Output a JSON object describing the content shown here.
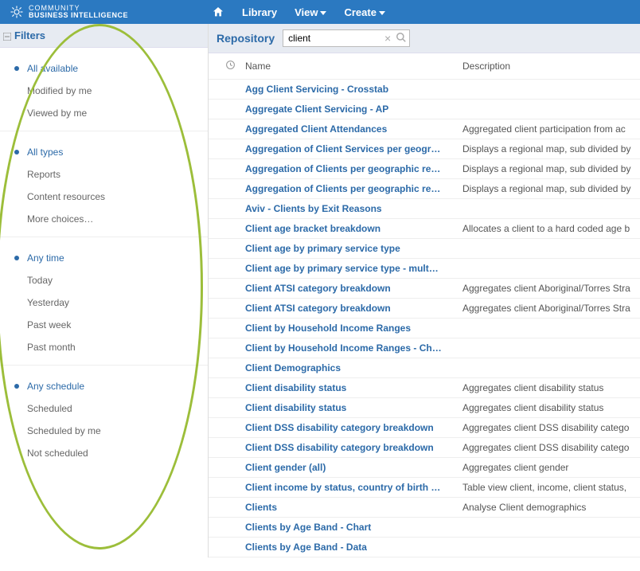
{
  "brand": {
    "line1": "COMMUNITY",
    "line2": "BUSINESS INTELLIGENCE"
  },
  "nav": {
    "library": "Library",
    "view": "View",
    "create": "Create"
  },
  "sidebar": {
    "title": "Filters",
    "groups": [
      {
        "items": [
          {
            "label": "All available",
            "selected": true
          },
          {
            "label": "Modified by me",
            "selected": false
          },
          {
            "label": "Viewed by me",
            "selected": false
          }
        ]
      },
      {
        "items": [
          {
            "label": "All types",
            "selected": true
          },
          {
            "label": "Reports",
            "selected": false
          },
          {
            "label": "Content resources",
            "selected": false
          },
          {
            "label": "More choices…",
            "selected": false
          }
        ]
      },
      {
        "items": [
          {
            "label": "Any time",
            "selected": true
          },
          {
            "label": "Today",
            "selected": false
          },
          {
            "label": "Yesterday",
            "selected": false
          },
          {
            "label": "Past week",
            "selected": false
          },
          {
            "label": "Past month",
            "selected": false
          }
        ]
      },
      {
        "items": [
          {
            "label": "Any schedule",
            "selected": true
          },
          {
            "label": "Scheduled",
            "selected": false
          },
          {
            "label": "Scheduled by me",
            "selected": false
          },
          {
            "label": "Not scheduled",
            "selected": false
          }
        ]
      }
    ]
  },
  "main": {
    "title": "Repository",
    "search_value": "client",
    "columns": {
      "name": "Name",
      "description": "Description"
    },
    "rows": [
      {
        "name": "Agg Client Servicing - Crosstab",
        "desc": ""
      },
      {
        "name": "Aggregate Client Servicing - AP",
        "desc": ""
      },
      {
        "name": "Aggregated Client Attendances",
        "desc": "Aggregated client participation from ac"
      },
      {
        "name": "Aggregation of Client Services per geogr…",
        "desc": "Displays a regional map, sub divided by"
      },
      {
        "name": "Aggregation of Clients per geographic re…",
        "desc": "Displays a regional map, sub divided by"
      },
      {
        "name": "Aggregation of Clients per geographic re…",
        "desc": "Displays a regional map, sub divided by"
      },
      {
        "name": "Aviv - Clients by Exit Reasons",
        "desc": ""
      },
      {
        "name": "Client age bracket breakdown",
        "desc": "Allocates a client to a hard coded age b"
      },
      {
        "name": "Client age by primary service type",
        "desc": ""
      },
      {
        "name": "Client age by primary service type - mult…",
        "desc": ""
      },
      {
        "name": "Client ATSI category breakdown",
        "desc": "Aggregates client Aboriginal/Torres Stra"
      },
      {
        "name": "Client ATSI category breakdown",
        "desc": "Aggregates client Aboriginal/Torres Stra"
      },
      {
        "name": "Client by Household Income Ranges",
        "desc": ""
      },
      {
        "name": "Client by Household Income Ranges - Ch…",
        "desc": ""
      },
      {
        "name": "Client Demographics",
        "desc": ""
      },
      {
        "name": "Client disability status",
        "desc": "Aggregates client disability status"
      },
      {
        "name": "Client disability status",
        "desc": "Aggregates client disability status"
      },
      {
        "name": "Client DSS disability category breakdown",
        "desc": "Aggregates client DSS disability catego"
      },
      {
        "name": "Client DSS disability category breakdown",
        "desc": "Aggregates client DSS disability catego"
      },
      {
        "name": "Client gender (all)",
        "desc": "Aggregates client gender"
      },
      {
        "name": "Client income by status, country of birth …",
        "desc": "Table view client, income, client status,"
      },
      {
        "name": "Clients",
        "desc": "Analyse Client demographics"
      },
      {
        "name": "Clients by Age Band - Chart",
        "desc": ""
      },
      {
        "name": "Clients by Age Band - Data",
        "desc": ""
      }
    ]
  }
}
